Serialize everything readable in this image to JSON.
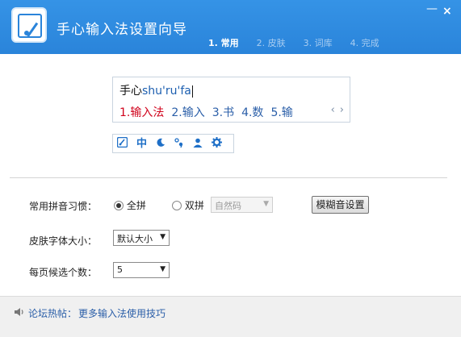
{
  "window": {
    "title": "手心输入法设置向导",
    "minimize_icon": "minimize-icon",
    "close_icon": "close-icon"
  },
  "steps": [
    {
      "label": "1. 常用",
      "active": true
    },
    {
      "label": "2. 皮肤",
      "active": false
    },
    {
      "label": "3. 词库",
      "active": false
    },
    {
      "label": "4. 完成",
      "active": false
    }
  ],
  "preview": {
    "typed_prefix": "手心",
    "typed_pinyin": "shu'ru'fa",
    "candidates": [
      "1.输入法",
      "2.输入",
      "3.书",
      "4.数",
      "5.输"
    ],
    "prev_icon": "‹",
    "next_icon": "›"
  },
  "statusbar": {
    "icons": [
      "logo-icon",
      "chinese-mode-icon",
      "moon-icon",
      "punctuation-icon",
      "user-icon",
      "gear-icon"
    ],
    "zh_label": "中"
  },
  "settings": {
    "pinyin_label": "常用拼音习惯：",
    "full_pinyin": "全拼",
    "double_pinyin": "双拼",
    "double_scheme": "自然码",
    "fuzzy_button": "模糊音设置",
    "font_label": "皮肤字体大小：",
    "font_value": "默认大小",
    "count_label": "每页候选个数：",
    "count_value": "5"
  },
  "footer": {
    "forum_label": "论坛热帖：",
    "forum_link": "更多输入法使用技巧"
  },
  "colors": {
    "header": "#2a84da",
    "candidate_first": "#d0021b",
    "link": "#2a5ea8"
  }
}
